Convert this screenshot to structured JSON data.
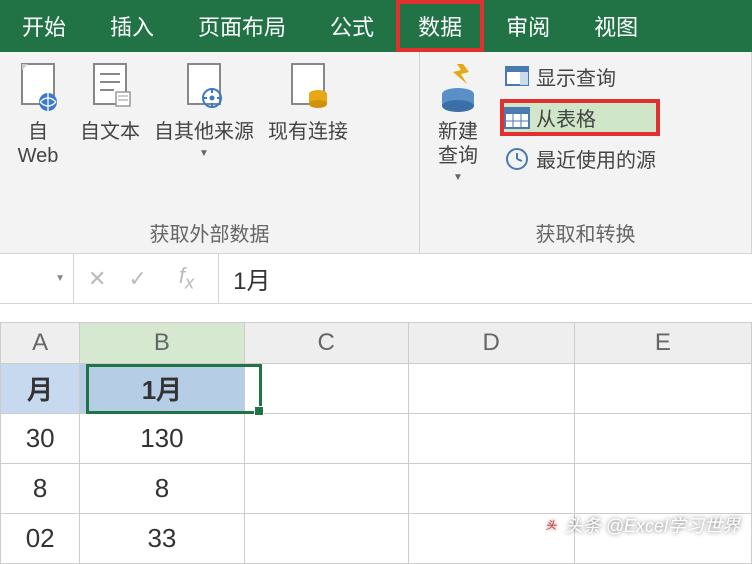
{
  "tabs": {
    "start": "开始",
    "insert": "插入",
    "page_layout": "页面布局",
    "formulas": "公式",
    "data": "数据",
    "review": "审阅",
    "view": "视图"
  },
  "ribbon": {
    "group1": {
      "from_web": "自\nWeb",
      "from_text": "自文本",
      "from_other": "自其他来源",
      "existing_conn": "现有连接",
      "label": "获取外部数据"
    },
    "group2": {
      "new_query": "新建\n查询",
      "show_queries": "显示查询",
      "from_table": "从表格",
      "recent_sources": "最近使用的源",
      "label": "获取和转换"
    }
  },
  "formula_bar": {
    "value": "1月"
  },
  "columns": {
    "A": "A",
    "B": "B",
    "C": "C",
    "D": "D",
    "E": "E"
  },
  "cells": {
    "A1": "月",
    "B1": "1月",
    "A2": "30",
    "B2": "130",
    "A3": "8",
    "B3": "8",
    "A4": "02",
    "B4": "33"
  },
  "watermark": "头条 @Excel学习世界"
}
